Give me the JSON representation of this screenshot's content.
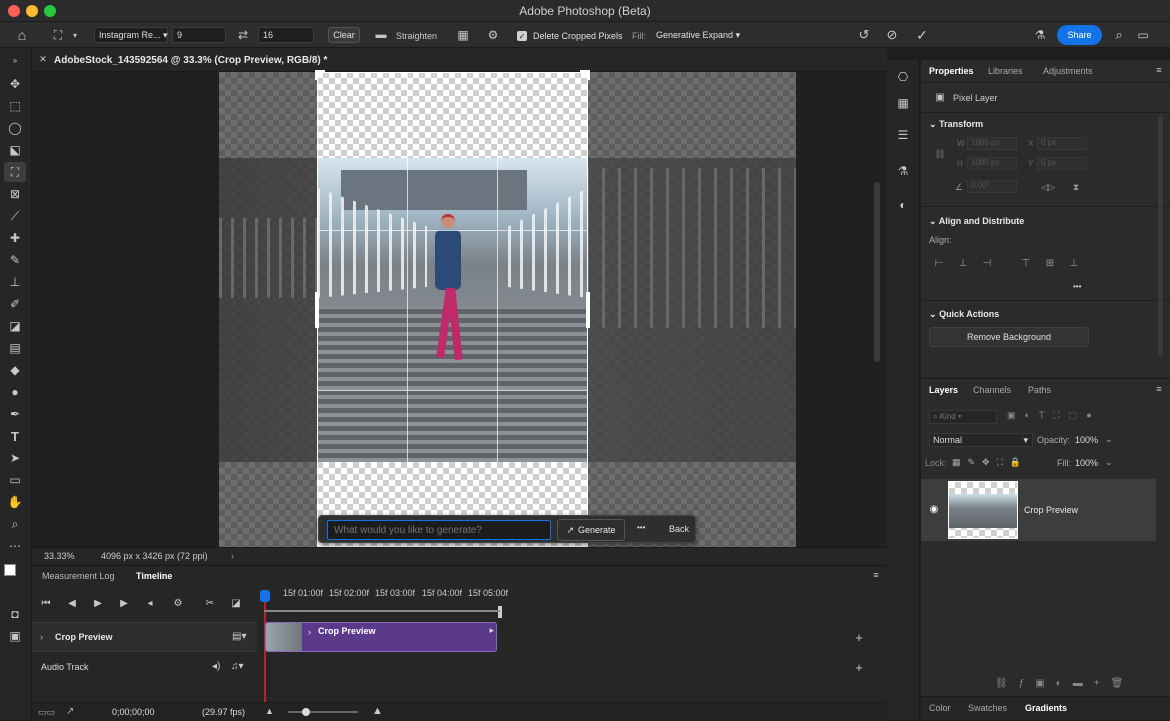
{
  "app": {
    "title": "Adobe Photoshop (Beta)"
  },
  "options_bar": {
    "preset": "Instagram Re...",
    "width_value": "9",
    "height_value": "16",
    "clear_label": "Clear",
    "straighten_label": "Straighten",
    "delete_cropped_label": "Delete Cropped Pixels",
    "fill_label": "Fill:",
    "fill_value": "Generative Expand",
    "share_label": "Share"
  },
  "document": {
    "tab_title": "AdobeStock_143592564 @ 33.3% (Crop Preview, RGB/8) *"
  },
  "generate_bar": {
    "placeholder": "What would you like to generate?",
    "generate_label": "Generate",
    "more_label": "•••",
    "back_label": "Back"
  },
  "status_bar": {
    "zoom": "33.33%",
    "doc_info": "4096 px x 3426 px (72 ppi)"
  },
  "timeline": {
    "tabs": [
      {
        "label": "Measurement Log"
      },
      {
        "label": "Timeline"
      }
    ],
    "ruler": [
      "15f",
      "01:00f",
      "15f",
      "02:00f",
      "15f",
      "03:00f",
      "15f",
      "04:00f",
      "15f",
      "05:00f"
    ],
    "track_name": "Crop Preview",
    "clip_name": "Crop Preview",
    "audio_track": "Audio Track",
    "timecode": "0;00;00;00",
    "fps": "(29.97 fps)"
  },
  "properties": {
    "tabs": [
      {
        "label": "Properties"
      },
      {
        "label": "Libraries"
      },
      {
        "label": "Adjustments"
      }
    ],
    "layer_type": "Pixel Layer",
    "transform_label": "Transform",
    "w_label": "W",
    "w_value": "1080 px",
    "x_label": "X",
    "x_value": "0 px",
    "h_label": "H",
    "h_value": "1080 px",
    "y_label": "Y",
    "y_value": "0 px",
    "angle_value": "0.00°",
    "align_header": "Align and Distribute",
    "align_label": "Align:",
    "more_label": "•••",
    "quick_actions_label": "Quick Actions",
    "remove_bg_label": "Remove Background"
  },
  "layers": {
    "tabs": [
      {
        "label": "Layers"
      },
      {
        "label": "Channels"
      },
      {
        "label": "Paths"
      }
    ],
    "kind_placeholder": "Kind",
    "blend_mode": "Normal",
    "opacity_label": "Opacity:",
    "opacity_value": "100%",
    "lock_label": "Lock:",
    "fill_label": "Fill:",
    "fill_value": "100%",
    "layer_name": "Crop Preview"
  },
  "bottom_tabs": [
    {
      "label": "Color"
    },
    {
      "label": "Swatches"
    },
    {
      "label": "Gradients"
    }
  ],
  "colors": {
    "accent": "#1473e6",
    "clip": "#5b3a8c"
  }
}
